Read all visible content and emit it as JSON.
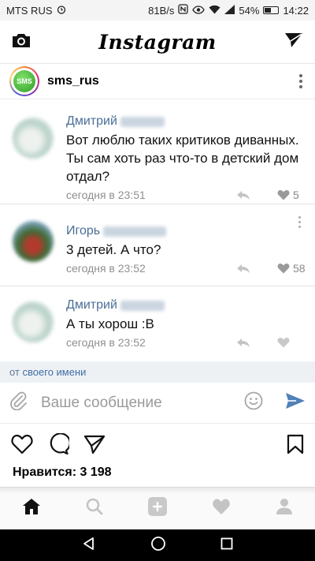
{
  "status_bar": {
    "carrier": "MTS RUS",
    "net_speed": "81B/s",
    "battery": "54%",
    "battery_level": 0.54,
    "time": "14:22"
  },
  "header": {
    "title": "Instagram"
  },
  "post": {
    "username": "sms_rus",
    "avatar_text": "SMS"
  },
  "comments": [
    {
      "author": "Дмитрий",
      "text": "Вот люблю таких критиков диванных. Ты сам хоть раз что-то в детский дом отдал?",
      "time": "сегодня в 23:51",
      "likes": "5"
    },
    {
      "author": "Игорь",
      "text": "3 детей. А что?",
      "time": "сегодня в 23:52",
      "likes": "58"
    },
    {
      "author": "Дмитрий",
      "text": "А ты хорош :В",
      "time": "сегодня в 23:52",
      "likes": ""
    }
  ],
  "composer": {
    "from_prefix": "от ",
    "from_link": "своего имени",
    "placeholder": "Ваше сообщение"
  },
  "likes_line": "Нравится: 3 198",
  "colors": {
    "link": "#4b6e98",
    "send": "#5181b8"
  }
}
